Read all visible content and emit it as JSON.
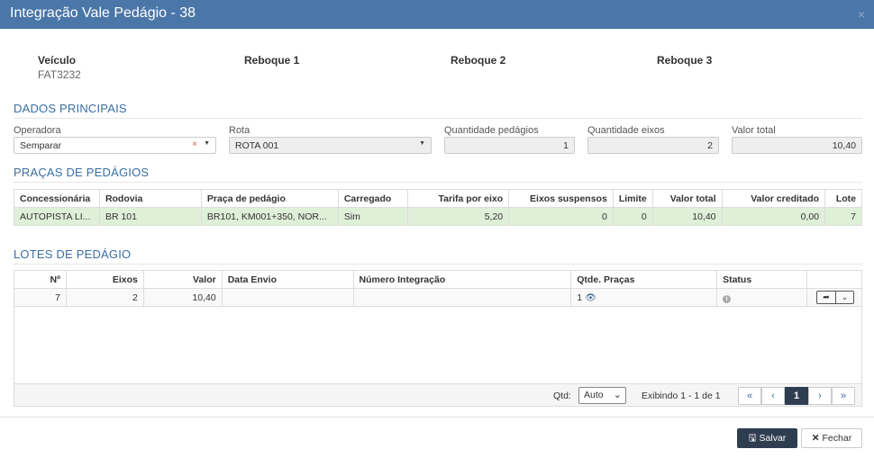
{
  "window": {
    "title": "Integração Vale Pedágio - 38",
    "close": "×"
  },
  "vehicle": [
    {
      "label": "Veículo",
      "value": "FAT3232"
    },
    {
      "label": "Reboque 1",
      "value": ""
    },
    {
      "label": "Reboque 2",
      "value": ""
    },
    {
      "label": "Reboque 3",
      "value": ""
    }
  ],
  "dados": {
    "title": "DADOS PRINCIPAIS",
    "operadora": {
      "label": "Operadora",
      "value": "Semparar",
      "clear": "×"
    },
    "rota": {
      "label": "Rota",
      "value": "ROTA 001"
    },
    "qtd_pedagios": {
      "label": "Quantidade pedágios",
      "value": "1"
    },
    "qtd_eixos": {
      "label": "Quantidade eixos",
      "value": "2"
    },
    "valor_total": {
      "label": "Valor total",
      "value": "10,40"
    }
  },
  "pracas": {
    "title": "PRAÇAS DE PEDÁGIOS",
    "columns": [
      "Concessionária",
      "Rodovia",
      "Praça de pedágio",
      "Carregado",
      "Tarifa por eixo",
      "Eixos suspensos",
      "Limite",
      "Valor total",
      "Valor creditado",
      "Lote"
    ],
    "rows": [
      [
        "AUTOPISTA LI...",
        "BR 101",
        "BR101, KM001+350, NOR...",
        "Sim",
        "5,20",
        "0",
        "0",
        "10,40",
        "0,00",
        "7"
      ]
    ]
  },
  "lotes": {
    "title": "LOTES DE PEDÁGIO",
    "columns": [
      "Nº",
      "Eixos",
      "Valor",
      "Data Envio",
      "Número Integração",
      "Qtde. Praças",
      "Status",
      ""
    ],
    "rows": [
      [
        "7",
        "2",
        "10,40",
        "",
        "",
        "1",
        "",
        ""
      ]
    ],
    "qtd_label": "Qtd:",
    "qtd_value": "Auto",
    "exibindo": "Exibindo 1 - 1 de 1",
    "pages": [
      "«",
      "‹",
      "1",
      "›",
      "»"
    ]
  },
  "footer": {
    "save": "Salvar",
    "close": "Fechar"
  },
  "colors": {
    "header": "#4a76a8",
    "accent": "#3a6ea5",
    "primary_button": "#2f3d51",
    "selected_row": "#dff0d8"
  }
}
